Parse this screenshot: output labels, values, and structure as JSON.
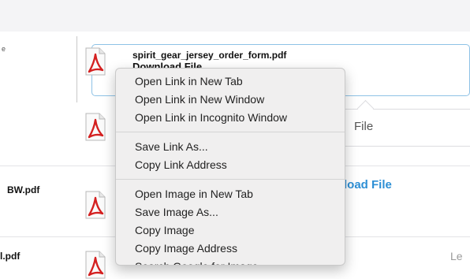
{
  "file_list": {
    "left_names": [
      "BW.pdf",
      "l.pdf"
    ],
    "highlighted": {
      "filename": "spirit_gear_jersey_order_form.pdf",
      "download_label": "Download File"
    },
    "partial_file_label": "File",
    "partial_upload_label": "load File",
    "partial_level_label": "Le",
    "left_tick": "e"
  },
  "context_menu": {
    "groups": [
      [
        "Open Link in New Tab",
        "Open Link in New Window",
        "Open Link in Incognito Window"
      ],
      [
        "Save Link As...",
        "Copy Link Address"
      ],
      [
        "Open Image in New Tab",
        "Save Image As...",
        "Copy Image",
        "Copy Image Address",
        "Search Google for Image"
      ]
    ]
  },
  "colors": {
    "accent": "#2d8fd5",
    "pdf_red": "#d42020",
    "highlight_border": "#8ec2e6"
  }
}
